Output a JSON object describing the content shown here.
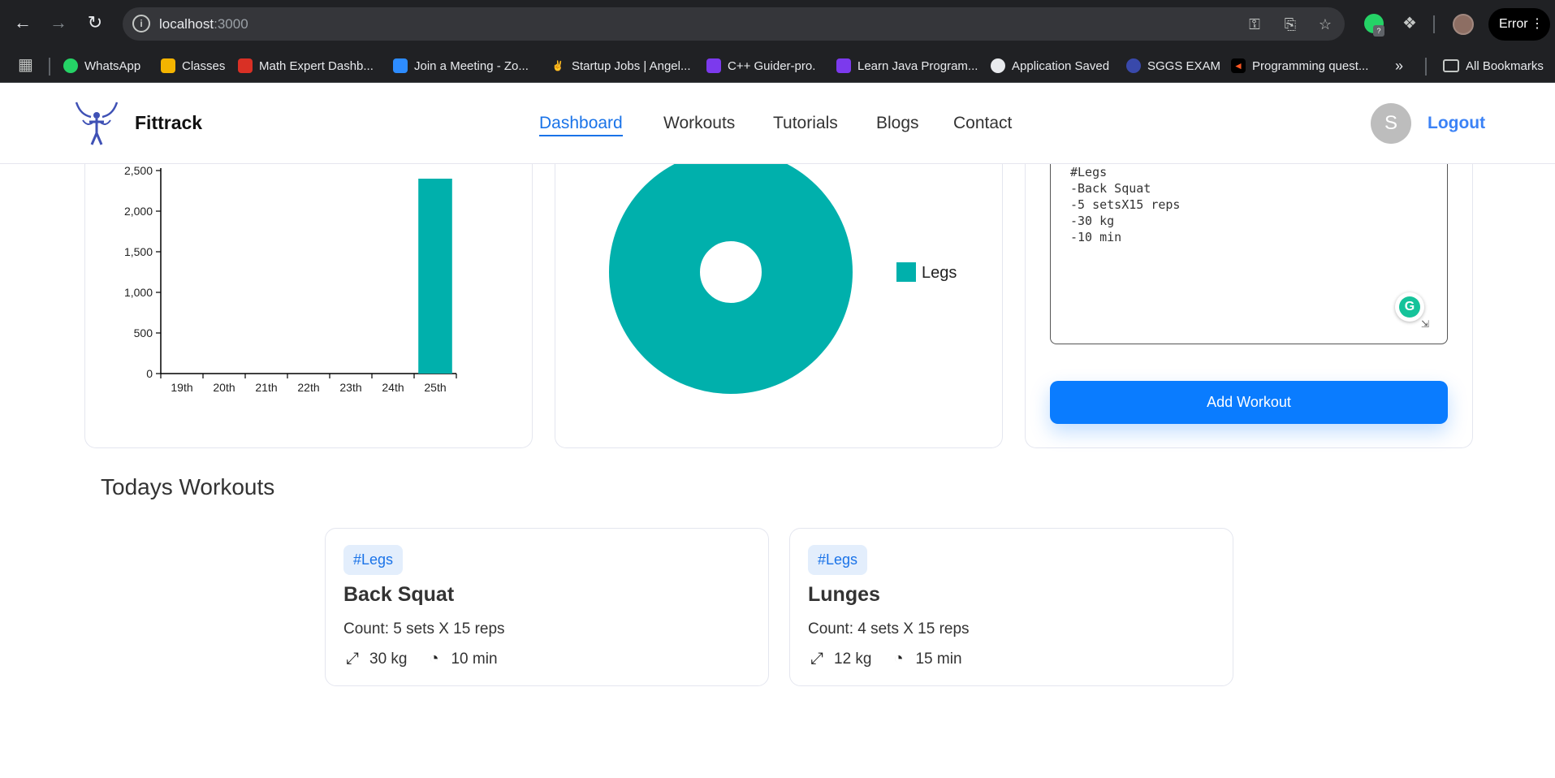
{
  "browser": {
    "url_host": "localhost",
    "url_port": ":3000",
    "profile_status": "Error"
  },
  "bookmarks": [
    {
      "label": "WhatsApp",
      "color": "#25d366"
    },
    {
      "label": "Classes",
      "color": "#f4b400"
    },
    {
      "label": "Math Expert Dashb...",
      "color": "#d93025"
    },
    {
      "label": "Join a Meeting - Zo...",
      "color": "#2d8cff"
    },
    {
      "label": "Startup Jobs | Angel...",
      "color": "#ffffff"
    },
    {
      "label": "C++ Guider-pro.",
      "color": "#7c3aed"
    },
    {
      "label": "Learn Java Program...",
      "color": "#7c3aed"
    },
    {
      "label": "Application Saved",
      "color": "#ffffff"
    },
    {
      "label": "SGGS EXAM",
      "color": "#3949ab"
    },
    {
      "label": "Programming quest...",
      "color": "#ff5722"
    }
  ],
  "all_bookmarks_label": "All Bookmarks",
  "app": {
    "brand": "Fittrack",
    "nav": {
      "dashboard": "Dashboard",
      "workouts": "Workouts",
      "tutorials": "Tutorials",
      "blogs": "Blogs",
      "contact": "Contact"
    },
    "avatar_letter": "S",
    "logout": "Logout"
  },
  "chart_data": [
    {
      "type": "bar",
      "categories": [
        "19th",
        "20th",
        "21th",
        "22th",
        "23th",
        "24th",
        "25th"
      ],
      "values": [
        0,
        0,
        0,
        0,
        0,
        0,
        2400
      ],
      "yticks": [
        "0",
        "500",
        "1,000",
        "1,500",
        "2,000",
        "2,500"
      ],
      "ylim": [
        0,
        2500
      ],
      "color": "#00b0ac",
      "grid": false
    },
    {
      "type": "pie",
      "categories": [
        "Legs"
      ],
      "values": [
        100
      ],
      "color": "#00b0ac",
      "donut": true,
      "legend": "right"
    }
  ],
  "add_workout": {
    "textarea_value": "#Legs\n-Back Squat\n-5 setsX15 reps\n-30 kg\n-10 min",
    "button": "Add Workout"
  },
  "todays": {
    "title": "Todays Workouts",
    "cards": [
      {
        "tag": "#Legs",
        "name": "Back Squat",
        "count": "Count: 5 sets X 15 reps",
        "weight": "30 kg",
        "duration": "10 min"
      },
      {
        "tag": "#Legs",
        "name": "Lunges",
        "count": "Count: 4 sets X 15 reps",
        "weight": "12 kg",
        "duration": "15 min"
      }
    ]
  },
  "accent_color": "#1a73e8",
  "button_color": "#0a7cff"
}
